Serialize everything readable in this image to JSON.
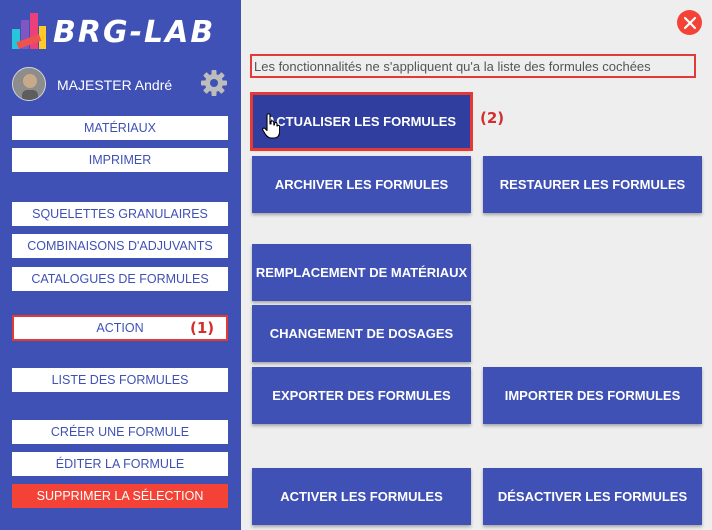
{
  "app": {
    "logo_text": "BRG-LAB"
  },
  "user": {
    "name": "MAJESTER André"
  },
  "sidebar": {
    "items": [
      {
        "label": "MATÉRIAUX"
      },
      {
        "label": "IMPRIMER"
      },
      {
        "label": "SQUELETTES GRANULAIRES"
      },
      {
        "label": "COMBINAISONS D'ADJUVANTS"
      },
      {
        "label": "CATALOGUES DE FORMULES"
      },
      {
        "label": "ACTION"
      },
      {
        "label": "LISTE DES FORMULES"
      },
      {
        "label": "CRÉER UNE FORMULE"
      },
      {
        "label": "ÉDITER LA FORMULE"
      },
      {
        "label": "SUPPRIMER LA SÉLECTION"
      }
    ]
  },
  "annotations": {
    "callout_1": "(1)",
    "callout_2": "(2)"
  },
  "main": {
    "notice": "Les fonctionnalités ne s'appliquent qu'a la liste des formules cochées",
    "buttons": [
      {
        "label": "ACTUALISER LES FORMULES"
      },
      {
        "label": "ARCHIVER LES FORMULES"
      },
      {
        "label": "RESTAURER LES FORMULES"
      },
      {
        "label": "REMPLACEMENT DE MATÉRIAUX"
      },
      {
        "label": "CHANGEMENT DE DOSAGES"
      },
      {
        "label": "EXPORTER DES FORMULES"
      },
      {
        "label": "IMPORTER DES FORMULES"
      },
      {
        "label": "ACTIVER LES FORMULES"
      },
      {
        "label": "DÉSACTIVER LES FORMULES"
      }
    ]
  },
  "icons": {
    "logo": "brg-lab-logo-icon",
    "settings": "gear-icon",
    "close": "close-icon",
    "cursor": "hand-pointer-icon"
  },
  "colors": {
    "primary": "#3f51b5",
    "primary_dark": "#303f9f",
    "danger": "#f44336",
    "highlight_border": "#e53935",
    "background": "#eeeeee"
  }
}
